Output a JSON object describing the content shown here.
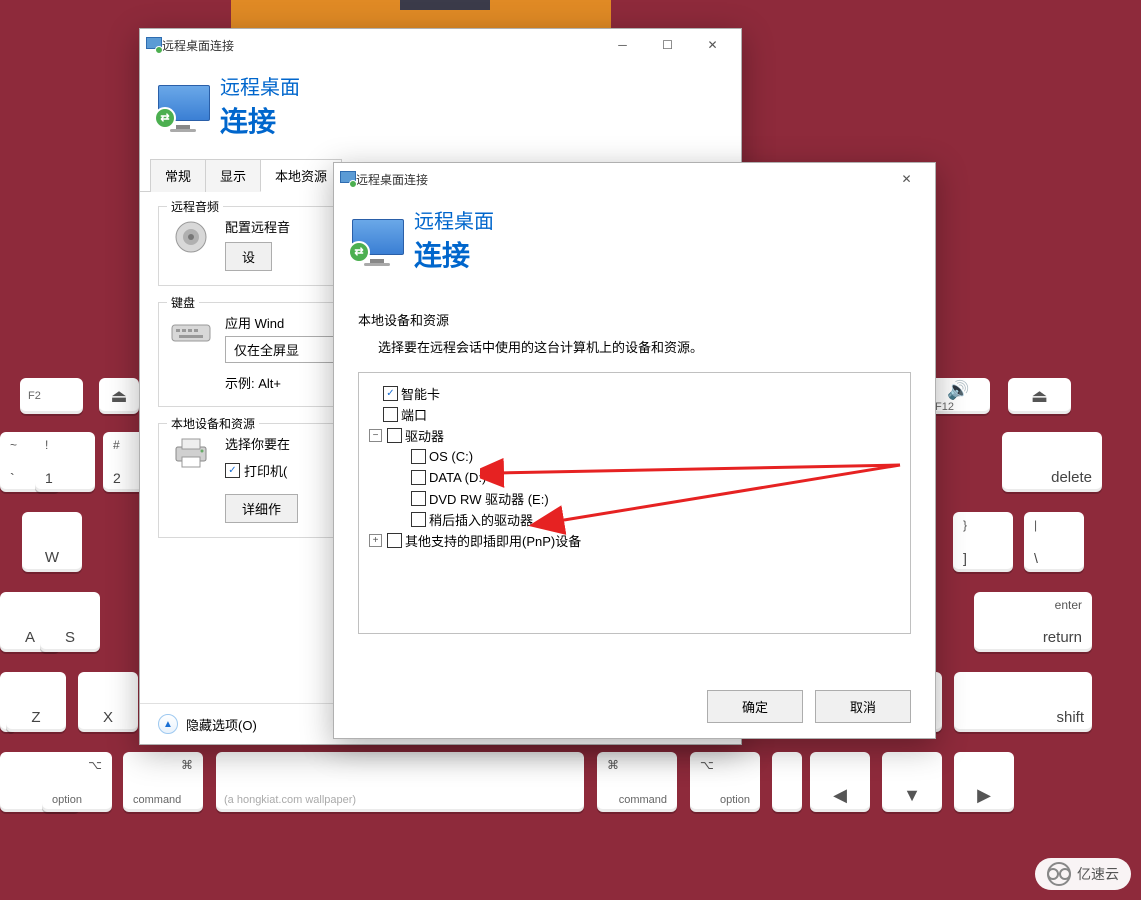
{
  "window1": {
    "title": "远程桌面连接",
    "banner_line1": "远程桌面",
    "banner_line2": "连接",
    "tabs": {
      "t0": "常规",
      "t1": "显示",
      "t2": "本地资源"
    },
    "group_audio": {
      "label": "远程音频",
      "text": "配置远程音",
      "button": "设"
    },
    "group_keyboard": {
      "label": "键盘",
      "text": "应用 Wind",
      "select": "仅在全屏显",
      "example": "示例: Alt+"
    },
    "group_local": {
      "label": "本地设备和资源",
      "text": "选择你要在",
      "printer": "打印机(",
      "button": "详细作"
    },
    "footer": "隐藏选项(O)"
  },
  "window2": {
    "title": "远程桌面连接",
    "banner_line1": "远程桌面",
    "banner_line2": "连接",
    "section_title": "本地设备和资源",
    "section_desc": "选择要在远程会话中使用的这台计算机上的设备和资源。",
    "tree": {
      "smartcard": "智能卡",
      "ports": "端口",
      "drives": "驱动器",
      "os": "OS (C:)",
      "data": "DATA (D:)",
      "dvd": "DVD RW 驱动器 (E:)",
      "later": "稍后插入的驱动器",
      "pnp": "其他支持的即插即用(PnP)设备"
    },
    "ok": "确定",
    "cancel": "取消"
  },
  "watermark": "亿速云",
  "kbd": {
    "wallpaper_text": "(a hongkiat.com wallpaper)",
    "command": "command",
    "option": "option",
    "shift": "shift",
    "enter": "enter",
    "return": "return",
    "delete": "delete",
    "f2": "F2",
    "f12": "F12"
  }
}
